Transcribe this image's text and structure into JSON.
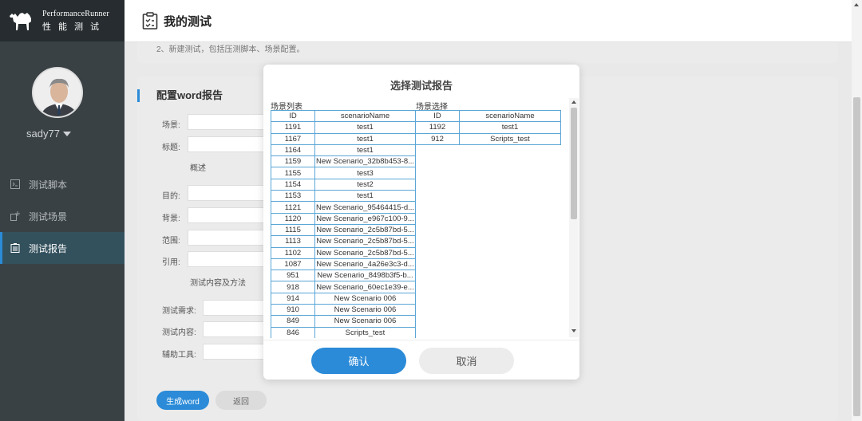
{
  "app": {
    "brand_en": "PerformanceRunner",
    "brand_cn": "性能测试"
  },
  "user": {
    "name": "sady77"
  },
  "sidebar": {
    "items": [
      {
        "label": "测试脚本",
        "icon": "script-icon"
      },
      {
        "label": "测试场景",
        "icon": "scene-icon"
      },
      {
        "label": "测试报告",
        "icon": "report-icon",
        "active": true
      }
    ]
  },
  "header": {
    "title": "我的测试"
  },
  "top_note": "2、新建测试，包括压测脚本、场景配置。",
  "form": {
    "title": "配置word报告",
    "scene_label": "场景:",
    "title_label": "标题:",
    "overview": "概述",
    "purpose_label": "目的:",
    "background_label": "背景:",
    "scope_label": "范围:",
    "reference_label": "引用:",
    "content_method": "测试内容及方法",
    "requirement_label": "测试需求:",
    "content_label": "测试内容:",
    "tools_label": "辅助工具:",
    "generate_btn": "生成word",
    "back_btn": "返回"
  },
  "modal": {
    "title": "选择测试报告",
    "left_label": "场景列表",
    "right_label": "场景选择",
    "columns": [
      "ID",
      "scenarioName"
    ],
    "scenario_list": [
      [
        "1191",
        "test1"
      ],
      [
        "1167",
        "test1"
      ],
      [
        "1164",
        "test1"
      ],
      [
        "1159",
        "New Scenario_32b8b453-8..."
      ],
      [
        "1155",
        "test3"
      ],
      [
        "1154",
        "test2"
      ],
      [
        "1153",
        "test1"
      ],
      [
        "1121",
        "New Scenario_95464415-d..."
      ],
      [
        "1120",
        "New Scenario_e967c100-9..."
      ],
      [
        "1115",
        "New Scenario_2c5b87bd-5..."
      ],
      [
        "1113",
        "New Scenario_2c5b87bd-5..."
      ],
      [
        "1102",
        "New Scenario_2c5b87bd-5..."
      ],
      [
        "1087",
        "New Scenario_4a26e3c3-d..."
      ],
      [
        "951",
        "New Scenario_8498b3f5-b..."
      ],
      [
        "918",
        "New Scenario_60ec1e39-e..."
      ],
      [
        "914",
        "New Scenario 006"
      ],
      [
        "910",
        "New Scenario 006"
      ],
      [
        "849",
        "New Scenario 006"
      ],
      [
        "846",
        "Scripts_test"
      ]
    ],
    "selected": [
      [
        "1192",
        "test1"
      ],
      [
        "912",
        "Scripts_test"
      ]
    ],
    "ok_btn": "确认",
    "cancel_btn": "取消"
  },
  "colors": {
    "accent": "#2b8bd8",
    "sidebar": "#3a4145",
    "grid_border": "#5aa6d6"
  }
}
